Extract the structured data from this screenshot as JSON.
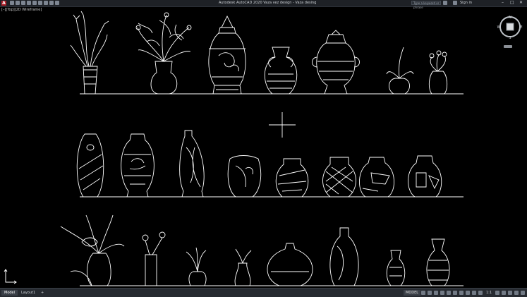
{
  "window": {
    "app_logo": "A",
    "title": "Autodesk AutoCAD 2020   Vaza vez design - Vaza desing",
    "search_placeholder": "Type a keyword or phrase",
    "sign_in": "Sign in",
    "controls": [
      "–",
      "□",
      "✕"
    ]
  },
  "viewport": {
    "label": "[–][Top][2D Wireframe]"
  },
  "viewcube": {
    "north": "N",
    "south": "S",
    "east": "E",
    "west": "W",
    "face": "TOP"
  },
  "status": {
    "tabs": [
      "Model",
      "Layout1",
      "+"
    ],
    "active_tab": "Model",
    "mode": "MODEL",
    "scale": "1:1"
  },
  "colors": {
    "canvas": "#000000",
    "lines": "#ffffff",
    "chrome": "#1e2126",
    "status": "#262a30"
  }
}
